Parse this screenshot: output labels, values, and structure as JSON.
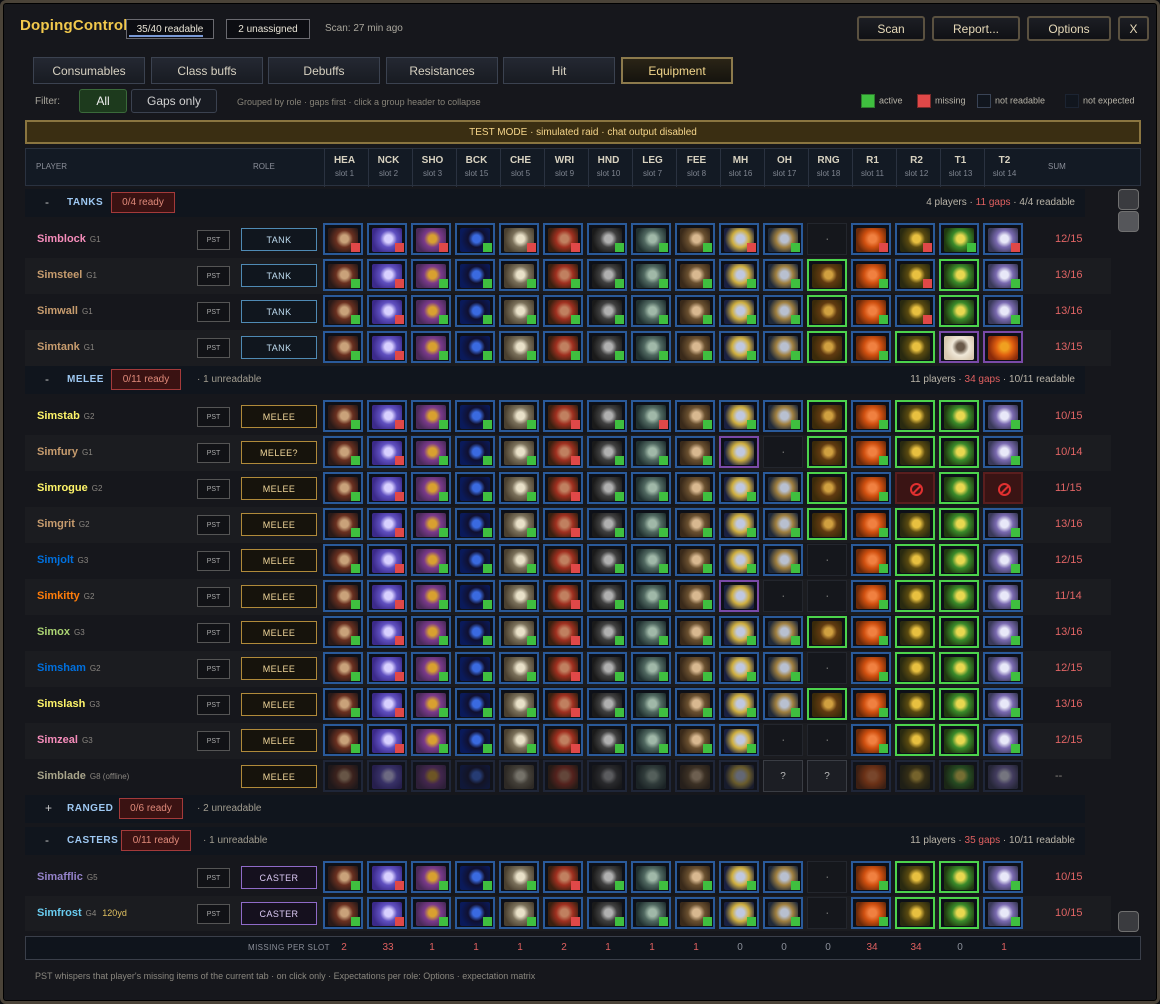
{
  "app_title": "DopingControl",
  "header": {
    "readable_pill": "35/40 readable",
    "readable_progress": 0.875,
    "unassigned_pill": "2 unassigned",
    "scan_info": "Scan: 27 min ago",
    "buttons": [
      "Scan",
      "Report...",
      "Options",
      "X"
    ]
  },
  "tabs": [
    "Consumables",
    "Class buffs",
    "Debuffs",
    "Resistances",
    "Hit",
    "Equipment"
  ],
  "active_tab": "Equipment",
  "filter": {
    "label": "Filter:",
    "options": [
      "All",
      "Gaps only"
    ],
    "selected": "All",
    "hint": "Grouped by role · gaps first · click a group header to collapse"
  },
  "legend": [
    {
      "label": "active",
      "color": "#3fbf3f"
    },
    {
      "label": "missing",
      "color": "#e04848"
    },
    {
      "label": "not readable",
      "color": "#2a3442"
    },
    {
      "label": "not expected",
      "color": "#141a24"
    }
  ],
  "banner": "TEST MODE · simulated raid · chat output disabled",
  "columns": {
    "player": "PLAYER",
    "role": "ROLE",
    "sum": "SUM",
    "slots": [
      {
        "abbr": "HEA",
        "slot": "slot 1"
      },
      {
        "abbr": "NCK",
        "slot": "slot 2"
      },
      {
        "abbr": "SHO",
        "slot": "slot 3"
      },
      {
        "abbr": "BCK",
        "slot": "slot 15"
      },
      {
        "abbr": "CHE",
        "slot": "slot 5"
      },
      {
        "abbr": "WRI",
        "slot": "slot 9"
      },
      {
        "abbr": "HND",
        "slot": "slot 10"
      },
      {
        "abbr": "LEG",
        "slot": "slot 7"
      },
      {
        "abbr": "FEE",
        "slot": "slot 8"
      },
      {
        "abbr": "MH",
        "slot": "slot 16"
      },
      {
        "abbr": "OH",
        "slot": "slot 17"
      },
      {
        "abbr": "RNG",
        "slot": "slot 18"
      },
      {
        "abbr": "R1",
        "slot": "slot 11"
      },
      {
        "abbr": "R2",
        "slot": "slot 12"
      },
      {
        "abbr": "T1",
        "slot": "slot 13"
      },
      {
        "abbr": "T2",
        "slot": "slot 14"
      }
    ]
  },
  "groups": [
    {
      "sign": "-",
      "name": "TANKS",
      "ready": "0/4 ready",
      "extra": "",
      "summary_a": "4 players · ",
      "summary_gaps": "11 gaps",
      "summary_b": " · 4/4 readable",
      "players": [
        {
          "name": "Simblock",
          "group": "G1",
          "color": "#f58cba",
          "pst": "PST",
          "role": "TANK",
          "role_type": "tank",
          "cells": "RRRGRRGGGRG-RRGR",
          "sum": "12/15"
        },
        {
          "name": "Simsteel",
          "group": "G1",
          "color": "#c79c6e",
          "pst": "PST",
          "role": "TANK",
          "role_type": "tank",
          "cells": "GRGGGGGGGGGXGRXG",
          "sum": "13/16"
        },
        {
          "name": "Simwall",
          "group": "G1",
          "color": "#c79c6e",
          "pst": "PST",
          "role": "TANK",
          "role_type": "tank",
          "cells": "GRGGGGGGGGGXGRXG",
          "sum": "13/16"
        },
        {
          "name": "Simtank",
          "group": "G1",
          "color": "#c79c6e",
          "pst": "PST",
          "role": "TANK",
          "role_type": "tank",
          "cells": "GRGGGGGGGGGXGXNN",
          "sum": "13/15"
        }
      ]
    },
    {
      "sign": "-",
      "name": "MELEE",
      "ready": "0/11 ready",
      "extra": "· 1 unreadable",
      "summary_a": "11 players · ",
      "summary_gaps": "34 gaps",
      "summary_b": " · 10/11 readable",
      "players": [
        {
          "name": "Simstab",
          "group": "G2",
          "color": "#fff569",
          "pst": "PST",
          "role": "MELEE",
          "role_type": "melee",
          "cells": "GRGGGRGRGGGXGXXG",
          "sum": "10/15"
        },
        {
          "name": "Simfury",
          "group": "G1",
          "color": "#c79c6e",
          "pst": "PST",
          "role": "MELEE?",
          "role_type": "melee",
          "cells": "GRGGGRGGGP-XGXXG",
          "sum": "10/14"
        },
        {
          "name": "Simrogue",
          "group": "G2",
          "color": "#fff569",
          "pst": "PST",
          "role": "MELEE",
          "role_type": "melee",
          "cells": "GRGGGRGGGGGXGBXB",
          "sum": "11/15"
        },
        {
          "name": "Simgrit",
          "group": "G2",
          "color": "#c79c6e",
          "pst": "PST",
          "role": "MELEE",
          "role_type": "melee",
          "cells": "GRGGGRGGGGGXGXXG",
          "sum": "13/16"
        },
        {
          "name": "Simjolt",
          "group": "G3",
          "color": "#0070de",
          "pst": "PST",
          "role": "MELEE",
          "role_type": "melee",
          "cells": "GRGGGRGGGGG-GXXG",
          "sum": "12/15"
        },
        {
          "name": "Simkitty",
          "group": "G2",
          "color": "#ff7d0a",
          "pst": "PST",
          "role": "MELEE",
          "role_type": "melee",
          "cells": "GRGGGRGGGP--GXXG",
          "sum": "11/14"
        },
        {
          "name": "Simox",
          "group": "G3",
          "color": "#abd473",
          "pst": "PST",
          "role": "MELEE",
          "role_type": "melee",
          "cells": "GRGGGRGGGGGXGXXG",
          "sum": "13/16"
        },
        {
          "name": "Simsham",
          "group": "G2",
          "color": "#0070de",
          "pst": "PST",
          "role": "MELEE",
          "role_type": "melee",
          "cells": "GRGGGRGGGGG-GXXG",
          "sum": "12/15"
        },
        {
          "name": "Simslash",
          "group": "G3",
          "color": "#fff569",
          "pst": "PST",
          "role": "MELEE",
          "role_type": "melee",
          "cells": "GRGGGRGGGGGXGXXG",
          "sum": "13/16"
        },
        {
          "name": "Simzeal",
          "group": "G3",
          "color": "#f58cba",
          "pst": "PST",
          "role": "MELEE",
          "role_type": "melee",
          "cells": "GRGGGRGGGG--GXXG",
          "sum": "12/15"
        },
        {
          "name": "Simblade",
          "group": "G8 (offline)",
          "color": "#a8a48a",
          "pst": "",
          "role": "MELEE",
          "role_type": "melee",
          "cells": "DDDDDDDDDDQQDDDD",
          "sum": "--"
        }
      ]
    },
    {
      "sign": "+",
      "name": "RANGED",
      "ready": "0/6 ready",
      "extra": "· 2 unreadable",
      "summary_a": "",
      "summary_gaps": "",
      "summary_b": "",
      "players": []
    },
    {
      "sign": "-",
      "name": "CASTERS",
      "ready": "0/11 ready",
      "extra": "· 1 unreadable",
      "summary_a": "11 players · ",
      "summary_gaps": "35 gaps",
      "summary_b": " · 10/11 readable",
      "players": [
        {
          "name": "Simafflic",
          "group": "G5",
          "color": "#9482c9",
          "pst": "PST",
          "role": "CASTER",
          "role_type": "caster",
          "cells": "GRGGGRGGGGG-GXXG",
          "sum": "10/15"
        },
        {
          "name": "Simfrost",
          "group": "G4",
          "range": "120yd",
          "color": "#69ccf0",
          "pst": "PST",
          "role": "CASTER",
          "role_type": "caster",
          "cells": "GRGGGRGGGGG-GXXG",
          "sum": "10/15"
        }
      ]
    }
  ],
  "footer": {
    "label": "MISSING PER SLOT",
    "values": [
      "2",
      "33",
      "1",
      "1",
      "1",
      "2",
      "1",
      "1",
      "1",
      "0",
      "0",
      "0",
      "34",
      "34",
      "0",
      "1"
    ]
  },
  "status_text": "PST whispers that player's missing items of the current tab · on click only · Expectations per role: Options · expectation matrix"
}
